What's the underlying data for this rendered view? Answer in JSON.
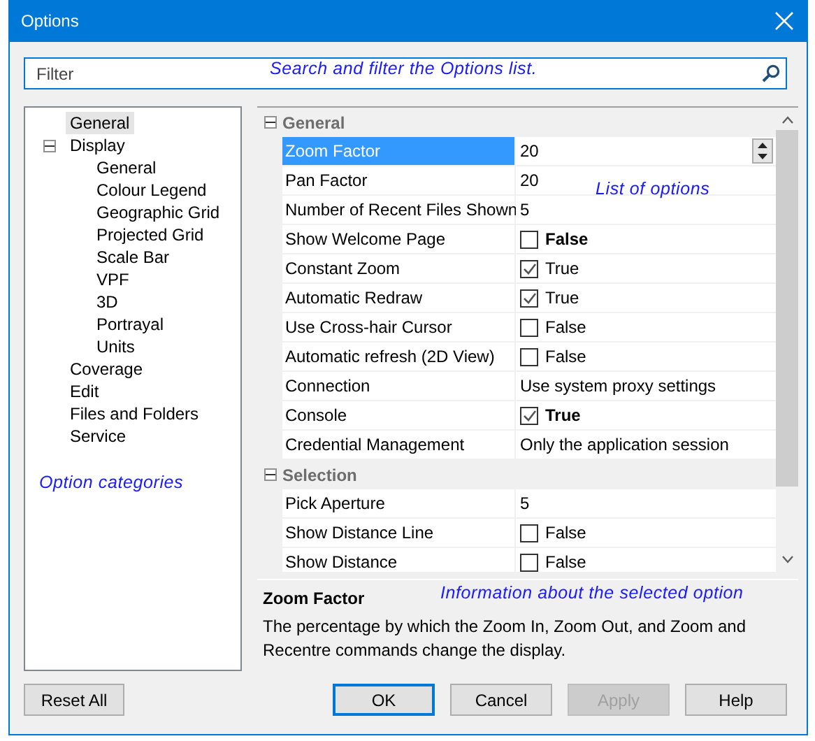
{
  "window": {
    "title": "Options"
  },
  "filter": {
    "placeholder": "Filter",
    "annotation": "Search and filter the Options list."
  },
  "tree": {
    "annotation": "Option categories",
    "items": [
      {
        "label": "General",
        "selected": true
      },
      {
        "label": "Display",
        "selected": false,
        "expanded": true,
        "children": [
          {
            "label": "General",
            "selected": false
          },
          {
            "label": "Colour Legend",
            "selected": false
          },
          {
            "label": "Geographic Grid",
            "selected": false
          },
          {
            "label": "Projected Grid",
            "selected": false
          },
          {
            "label": "Scale Bar",
            "selected": false
          },
          {
            "label": "VPF",
            "selected": false
          },
          {
            "label": "3D",
            "selected": false
          },
          {
            "label": "Portrayal",
            "selected": false
          },
          {
            "label": "Units",
            "selected": false
          }
        ]
      },
      {
        "label": "Coverage",
        "selected": false
      },
      {
        "label": "Edit",
        "selected": false
      },
      {
        "label": "Files and Folders",
        "selected": false
      },
      {
        "label": "Service",
        "selected": false
      }
    ]
  },
  "grid": {
    "annotation": "List of options",
    "groups": [
      {
        "title": "General",
        "expanded": true,
        "rows": [
          {
            "name": "Zoom Factor",
            "kind": "spin",
            "value": "20",
            "selected": true,
            "modified": false
          },
          {
            "name": "Pan Factor",
            "kind": "text",
            "value": "20",
            "selected": false,
            "modified": false
          },
          {
            "name": "Number of Recent Files Shown",
            "kind": "text",
            "value": "5",
            "selected": false,
            "modified": false
          },
          {
            "name": "Show Welcome Page",
            "kind": "check",
            "value": "False",
            "checked": false,
            "selected": false,
            "modified": true
          },
          {
            "name": "Constant Zoom",
            "kind": "check",
            "value": "True",
            "checked": true,
            "selected": false,
            "modified": false
          },
          {
            "name": "Automatic Redraw",
            "kind": "check",
            "value": "True",
            "checked": true,
            "selected": false,
            "modified": false
          },
          {
            "name": "Use Cross-hair Cursor",
            "kind": "check",
            "value": "False",
            "checked": false,
            "selected": false,
            "modified": false
          },
          {
            "name": "Automatic refresh (2D View)",
            "kind": "check",
            "value": "False",
            "checked": false,
            "selected": false,
            "modified": false
          },
          {
            "name": "Connection",
            "kind": "text",
            "value": "Use system proxy settings",
            "selected": false,
            "modified": false
          },
          {
            "name": "Console",
            "kind": "check",
            "value": "True",
            "checked": true,
            "selected": false,
            "modified": true
          },
          {
            "name": "Credential Management",
            "kind": "text",
            "value": "Only the application session",
            "selected": false,
            "modified": false
          }
        ]
      },
      {
        "title": "Selection",
        "expanded": true,
        "rows": [
          {
            "name": "Pick Aperture",
            "kind": "text",
            "value": "5",
            "selected": false,
            "modified": false
          },
          {
            "name": "Show Distance Line",
            "kind": "check",
            "value": "False",
            "checked": false,
            "selected": false,
            "modified": false
          },
          {
            "name": "Show Distance",
            "kind": "check",
            "value": "False",
            "checked": false,
            "selected": false,
            "modified": false
          }
        ]
      }
    ]
  },
  "info": {
    "annotation": "Information about the selected option",
    "title": "Zoom Factor",
    "description": "The percentage by which the Zoom In, Zoom Out, and Zoom and Recentre commands change the display."
  },
  "buttons": {
    "reset": {
      "label": "Reset All",
      "disabled": false
    },
    "actions": [
      {
        "label": "OK",
        "disabled": false,
        "default": true
      },
      {
        "label": "Cancel",
        "disabled": false,
        "default": false
      },
      {
        "label": "Apply",
        "disabled": true,
        "default": false
      },
      {
        "label": "Help",
        "disabled": false,
        "default": false
      }
    ]
  }
}
